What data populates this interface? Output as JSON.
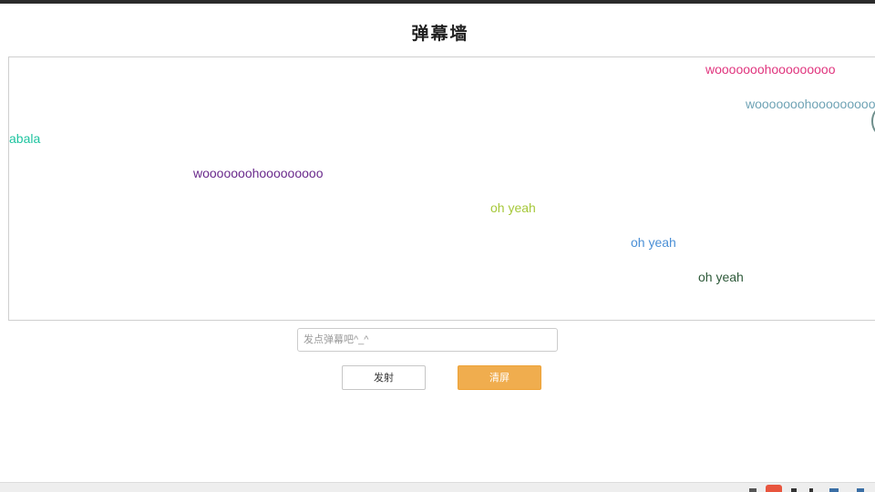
{
  "page": {
    "title": "弹幕墙"
  },
  "danmaku": [
    {
      "text": "wooooooohooooooooo",
      "color": "#e0357e"
    },
    {
      "text": "wooooooohooooooooo",
      "color": "#6fa3b5"
    },
    {
      "text": "lalabala",
      "color": "#1fc4a0"
    },
    {
      "text": "wooooooohooooooooo",
      "color": "#6a2a8c"
    },
    {
      "text": "oh yeah",
      "color": "#a6c83a"
    },
    {
      "text": "oh yeah",
      "color": "#4a8fd6"
    },
    {
      "text": "oh yeah",
      "color": "#2e5a3a"
    }
  ],
  "form": {
    "input_placeholder": "发点弹幕吧^_^",
    "input_value": "",
    "send_label": "发射",
    "clear_label": "清屏"
  },
  "colors": {
    "accent": "#f0ad4e"
  },
  "taskbar": {
    "icons": [
      "flag-icon",
      "html5-icon",
      "tray-icon"
    ]
  }
}
